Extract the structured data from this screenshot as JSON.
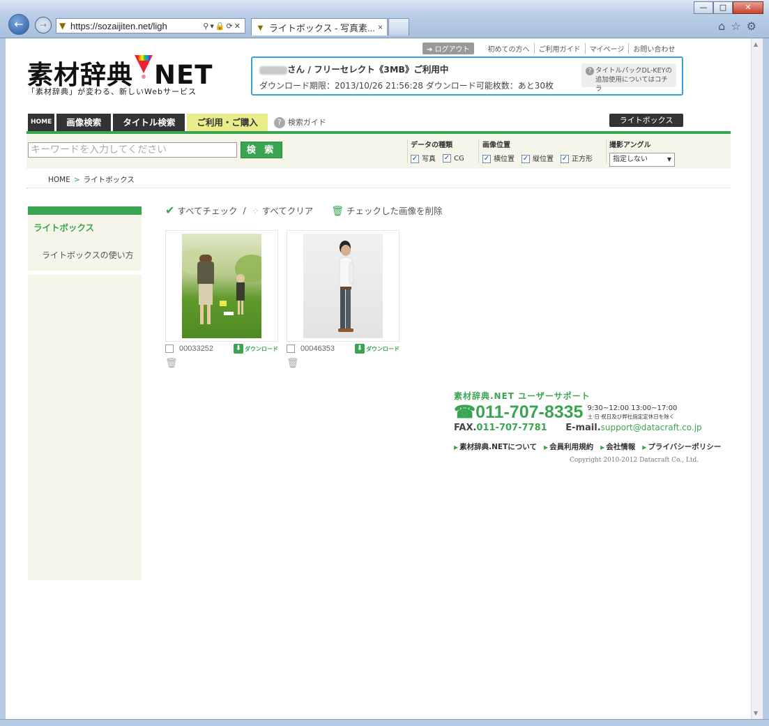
{
  "browser": {
    "url": "https://sozaijiten.net/ligh",
    "tab_title": "ライトボックス - 写真素...",
    "tab_close": "×",
    "win_minimize": "—",
    "win_maximize": "□",
    "win_close": "✕"
  },
  "header": {
    "logout": "➔ ログアウト",
    "links": [
      "初めての方へ",
      "ご利用ガイド",
      "マイページ",
      "お問い合わせ"
    ],
    "logo_left": "素材辞典",
    "logo_right": "NET",
    "tagline": "「素材辞典」が変わる、新しいWebサービス",
    "user_status": "さん / フリーセレクト《3MB》ご利用中",
    "download_info": "ダウンロード期限：2013/10/26 21:56:28  ダウンロード可能枚数：あと30枚",
    "dlkey_line1": "タイトルパックDL-KEYの",
    "dlkey_line2": "追加使用についてはコチラ"
  },
  "nav": {
    "home": "HOME",
    "image_search": "画像検索",
    "title_search": "タイトル検索",
    "purchase": "ご利用・ご購入",
    "search_guide": "検索ガイド",
    "lightbox": "ライトボックス"
  },
  "search": {
    "placeholder": "キーワードを入力してください",
    "button": "検 索",
    "data_type_title": "データの種類",
    "data_types": [
      "写真",
      "CG"
    ],
    "position_title": "画像位置",
    "positions": [
      "横位置",
      "縦位置",
      "正方形"
    ],
    "angle_title": "撮影アングル",
    "angle_value": "指定しない"
  },
  "breadcrumb": {
    "home": "HOME",
    "current": "ライトボックス"
  },
  "sidebar": {
    "title": "ライトボックス",
    "link": "ライトボックスの使い方"
  },
  "actions": {
    "check_all": "すべてチェック",
    "separator": "/",
    "clear_all": "すべてクリア",
    "delete_checked": "チェックした画像を削除"
  },
  "items": [
    {
      "id": "00033252",
      "download": "ダウンロード"
    },
    {
      "id": "00046353",
      "download": "ダウンロード"
    }
  ],
  "footer": {
    "support_title": "素材辞典.NET ユーザーサポート",
    "tel": "011-707-8335",
    "hours": "9:30~12:00  13:00~17:00",
    "hours_note": "土·日·祝日及び弊社指定定休日を除く",
    "fax_label": "FAX.",
    "fax": "011-707-7781",
    "email_label": "E-mail.",
    "email": "support@datacraft.co.jp",
    "links": [
      "素材辞典.NETについて",
      "会員利用規約",
      "会社情報",
      "プライバシーポリシー"
    ],
    "copyright": "Copyright 2010-2012 Datacraft Co., Ltd."
  }
}
